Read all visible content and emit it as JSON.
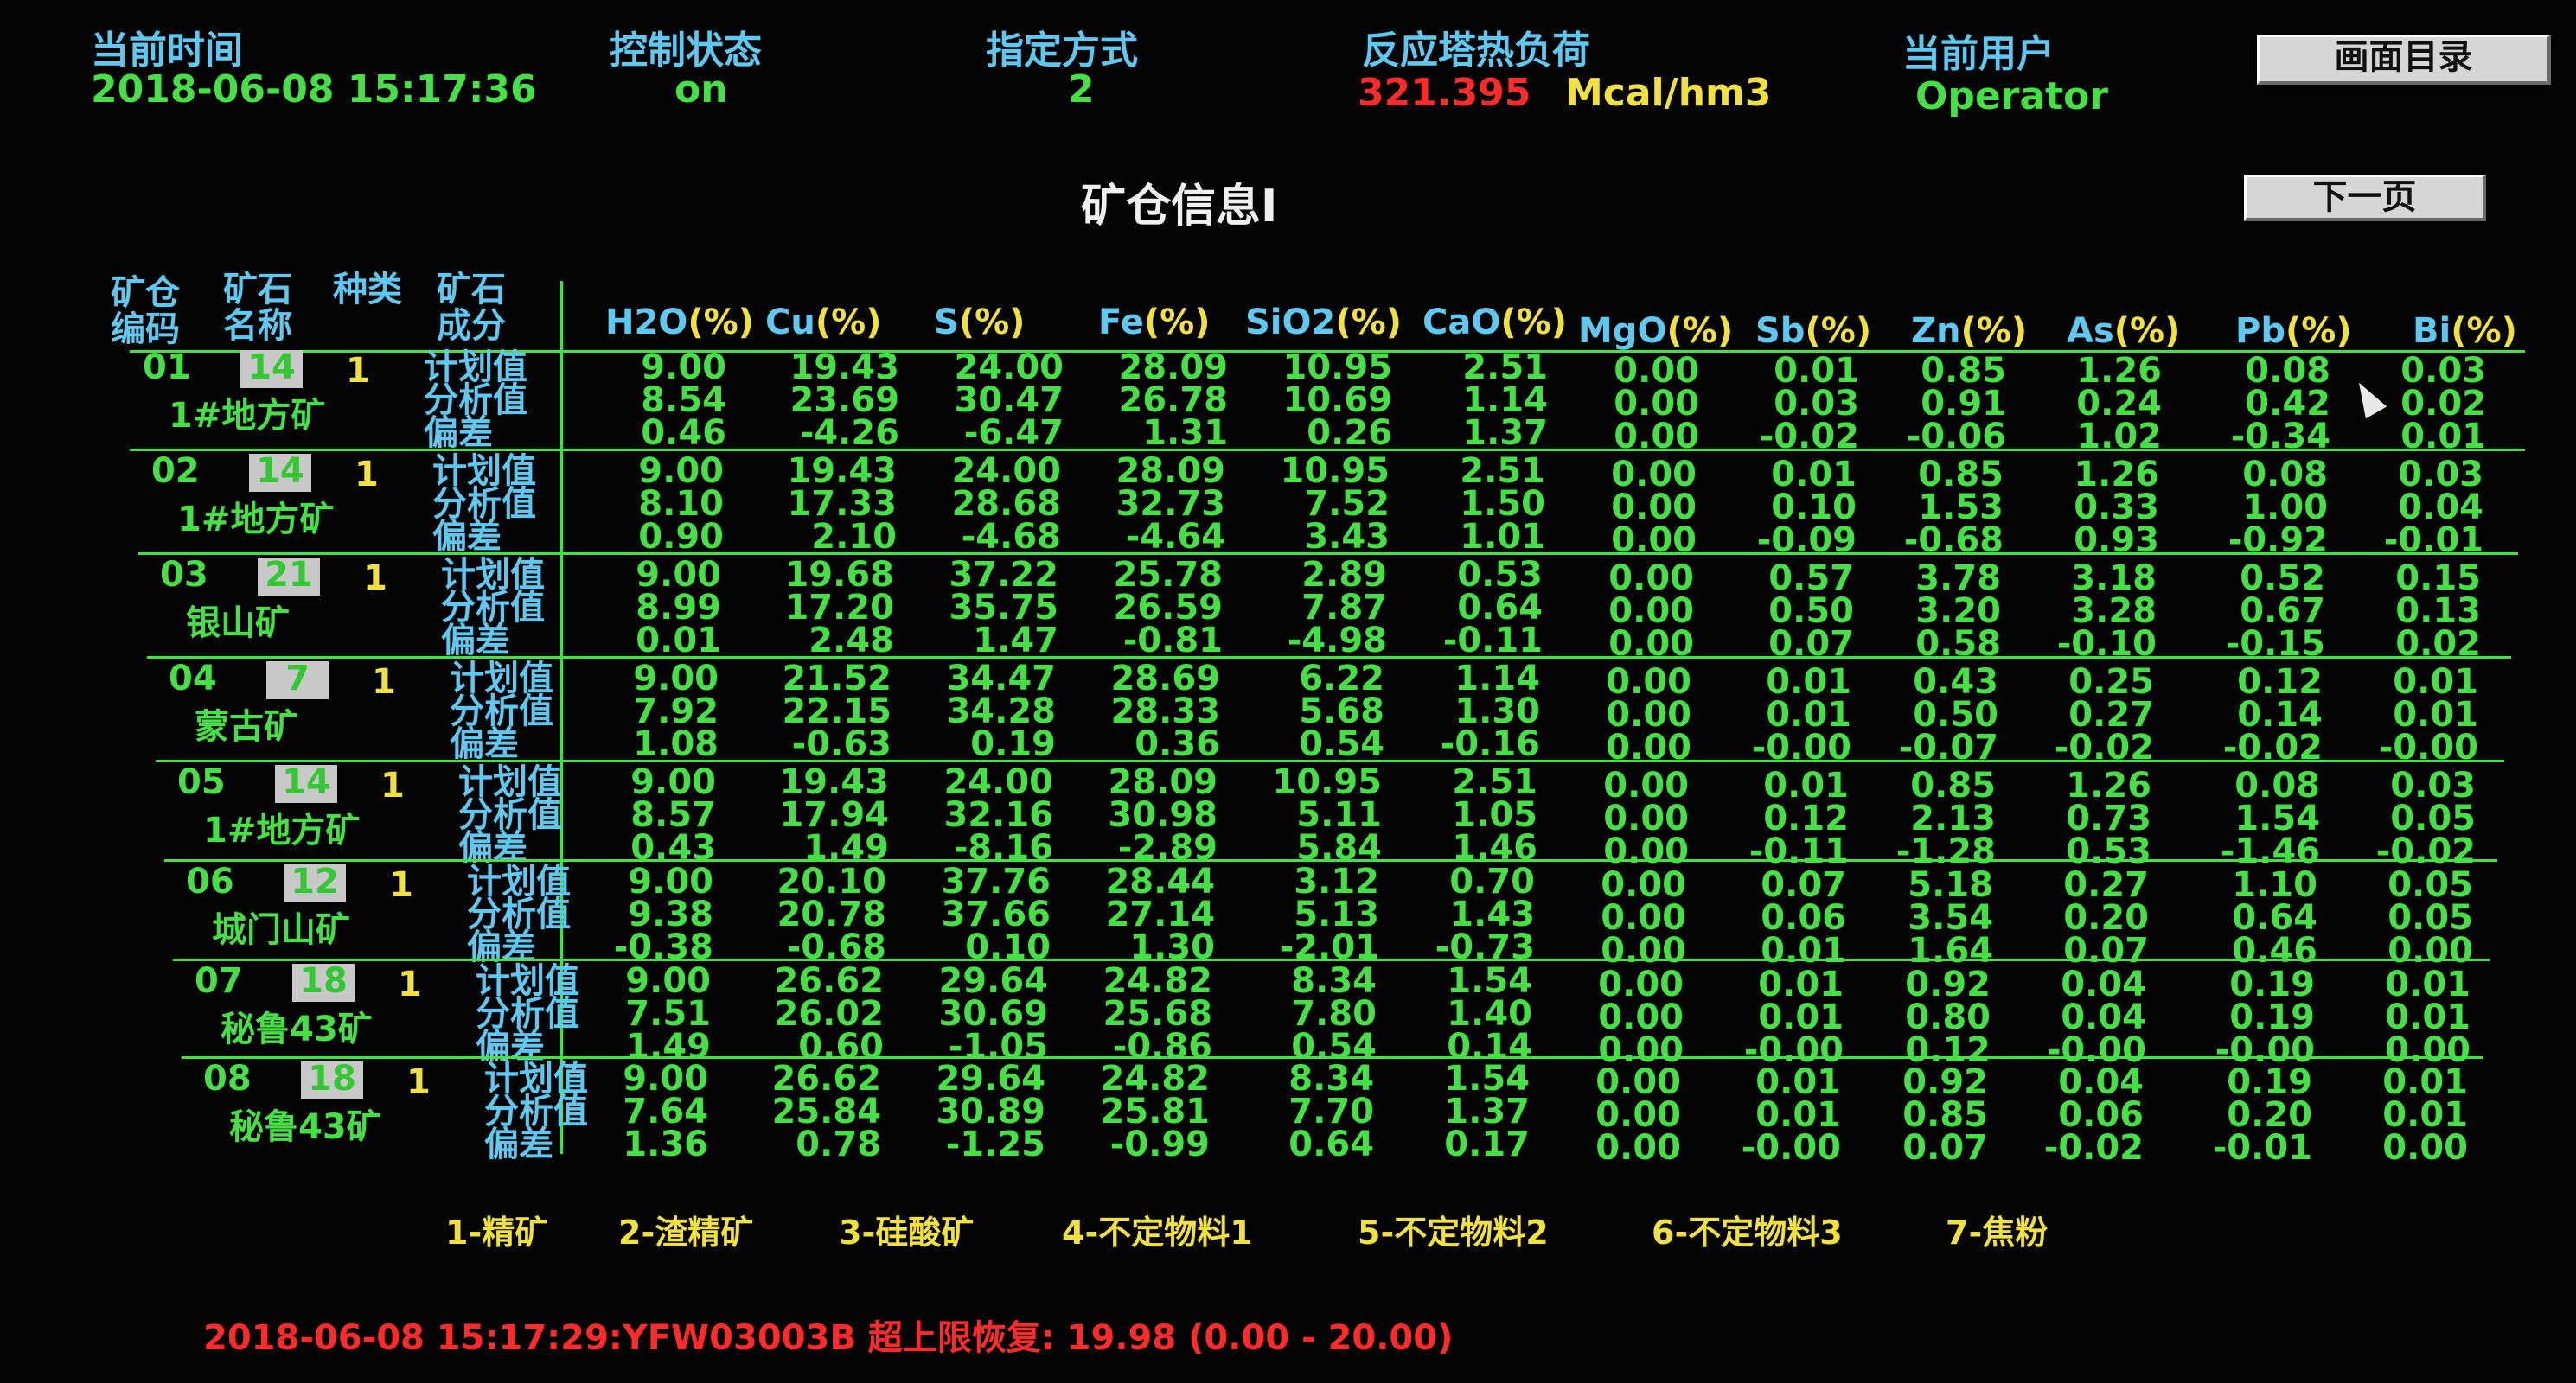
{
  "header": {
    "time_label": "当前时间",
    "time_value": "2018-06-08 15:17:36",
    "control_label": "控制状态",
    "control_value": "on",
    "mode_label": "指定方式",
    "mode_value": "2",
    "heat_label": "反应塔热负荷",
    "heat_value": "321.395",
    "heat_unit": "Mcal/hm3",
    "user_label": "当前用户",
    "user_value": "Operator",
    "menu_button": "画面目录",
    "next_button": "下一页"
  },
  "title": "矿仓信息Ⅰ",
  "table_header": {
    "bin_code_line1": "矿仓",
    "bin_code_line2": "编码",
    "ore_type_line1": "矿石",
    "ore_type_line2": "名称",
    "ore_kind_line1": "种类",
    "component_line1": "矿石",
    "component_line2": "成分",
    "pct": "(%)",
    "columns": [
      "H2O",
      "Cu",
      "S",
      "Fe",
      "SiO2",
      "CaO",
      "MgO",
      "Sb",
      "Zn",
      "As",
      "Pb",
      "Bi"
    ]
  },
  "row_labels": [
    "计划值",
    "分析值",
    "偏差"
  ],
  "bins": [
    {
      "code": "01",
      "ore_type": "14",
      "kind": "1",
      "name": "1#地方矿",
      "plan": [
        "9.00",
        "19.43",
        "24.00",
        "28.09",
        "10.95",
        "2.51",
        "0.00",
        "0.01",
        "0.85",
        "1.26",
        "0.08",
        "0.03"
      ],
      "analysis": [
        "8.54",
        "23.69",
        "30.47",
        "26.78",
        "10.69",
        "1.14",
        "0.00",
        "0.03",
        "0.91",
        "0.24",
        "0.42",
        "0.02"
      ],
      "deviation": [
        "0.46",
        "-4.26",
        "-6.47",
        "1.31",
        "0.26",
        "1.37",
        "0.00",
        "-0.02",
        "-0.06",
        "1.02",
        "-0.34",
        "0.01"
      ]
    },
    {
      "code": "02",
      "ore_type": "14",
      "kind": "1",
      "name": "1#地方矿",
      "plan": [
        "9.00",
        "19.43",
        "24.00",
        "28.09",
        "10.95",
        "2.51",
        "0.00",
        "0.01",
        "0.85",
        "1.26",
        "0.08",
        "0.03"
      ],
      "analysis": [
        "8.10",
        "17.33",
        "28.68",
        "32.73",
        "7.52",
        "1.50",
        "0.00",
        "0.10",
        "1.53",
        "0.33",
        "1.00",
        "0.04"
      ],
      "deviation": [
        "0.90",
        "2.10",
        "-4.68",
        "-4.64",
        "3.43",
        "1.01",
        "0.00",
        "-0.09",
        "-0.68",
        "0.93",
        "-0.92",
        "-0.01"
      ]
    },
    {
      "code": "03",
      "ore_type": "21",
      "kind": "1",
      "name": "银山矿",
      "plan": [
        "9.00",
        "19.68",
        "37.22",
        "25.78",
        "2.89",
        "0.53",
        "0.00",
        "0.57",
        "3.78",
        "3.18",
        "0.52",
        "0.15"
      ],
      "analysis": [
        "8.99",
        "17.20",
        "35.75",
        "26.59",
        "7.87",
        "0.64",
        "0.00",
        "0.50",
        "3.20",
        "3.28",
        "0.67",
        "0.13"
      ],
      "deviation": [
        "0.01",
        "2.48",
        "1.47",
        "-0.81",
        "-4.98",
        "-0.11",
        "0.00",
        "0.07",
        "0.58",
        "-0.10",
        "-0.15",
        "0.02"
      ]
    },
    {
      "code": "04",
      "ore_type": "7",
      "kind": "1",
      "name": "蒙古矿",
      "plan": [
        "9.00",
        "21.52",
        "34.47",
        "28.69",
        "6.22",
        "1.14",
        "0.00",
        "0.01",
        "0.43",
        "0.25",
        "0.12",
        "0.01"
      ],
      "analysis": [
        "7.92",
        "22.15",
        "34.28",
        "28.33",
        "5.68",
        "1.30",
        "0.00",
        "0.01",
        "0.50",
        "0.27",
        "0.14",
        "0.01"
      ],
      "deviation": [
        "1.08",
        "-0.63",
        "0.19",
        "0.36",
        "0.54",
        "-0.16",
        "0.00",
        "-0.00",
        "-0.07",
        "-0.02",
        "-0.02",
        "-0.00"
      ]
    },
    {
      "code": "05",
      "ore_type": "14",
      "kind": "1",
      "name": "1#地方矿",
      "plan": [
        "9.00",
        "19.43",
        "24.00",
        "28.09",
        "10.95",
        "2.51",
        "0.00",
        "0.01",
        "0.85",
        "1.26",
        "0.08",
        "0.03"
      ],
      "analysis": [
        "8.57",
        "17.94",
        "32.16",
        "30.98",
        "5.11",
        "1.05",
        "0.00",
        "0.12",
        "2.13",
        "0.73",
        "1.54",
        "0.05"
      ],
      "deviation": [
        "0.43",
        "1.49",
        "-8.16",
        "-2.89",
        "5.84",
        "1.46",
        "0.00",
        "-0.11",
        "-1.28",
        "0.53",
        "-1.46",
        "-0.02"
      ]
    },
    {
      "code": "06",
      "ore_type": "12",
      "kind": "1",
      "name": "城门山矿",
      "plan": [
        "9.00",
        "20.10",
        "37.76",
        "28.44",
        "3.12",
        "0.70",
        "0.00",
        "0.07",
        "5.18",
        "0.27",
        "1.10",
        "0.05"
      ],
      "analysis": [
        "9.38",
        "20.78",
        "37.66",
        "27.14",
        "5.13",
        "1.43",
        "0.00",
        "0.06",
        "3.54",
        "0.20",
        "0.64",
        "0.05"
      ],
      "deviation": [
        "-0.38",
        "-0.68",
        "0.10",
        "1.30",
        "-2.01",
        "-0.73",
        "0.00",
        "0.01",
        "1.64",
        "0.07",
        "0.46",
        "0.00"
      ]
    },
    {
      "code": "07",
      "ore_type": "18",
      "kind": "1",
      "name": "秘鲁43矿",
      "plan": [
        "9.00",
        "26.62",
        "29.64",
        "24.82",
        "8.34",
        "1.54",
        "0.00",
        "0.01",
        "0.92",
        "0.04",
        "0.19",
        "0.01"
      ],
      "analysis": [
        "7.51",
        "26.02",
        "30.69",
        "25.68",
        "7.80",
        "1.40",
        "0.00",
        "0.01",
        "0.80",
        "0.04",
        "0.19",
        "0.01"
      ],
      "deviation": [
        "1.49",
        "0.60",
        "-1.05",
        "-0.86",
        "0.54",
        "0.14",
        "0.00",
        "-0.00",
        "0.12",
        "-0.00",
        "-0.00",
        "0.00"
      ]
    },
    {
      "code": "08",
      "ore_type": "18",
      "kind": "1",
      "name": "秘鲁43矿",
      "plan": [
        "9.00",
        "26.62",
        "29.64",
        "24.82",
        "8.34",
        "1.54",
        "0.00",
        "0.01",
        "0.92",
        "0.04",
        "0.19",
        "0.01"
      ],
      "analysis": [
        "7.64",
        "25.84",
        "30.89",
        "25.81",
        "7.70",
        "1.37",
        "0.00",
        "0.01",
        "0.85",
        "0.06",
        "0.20",
        "0.01"
      ],
      "deviation": [
        "1.36",
        "0.78",
        "-1.25",
        "-0.99",
        "0.64",
        "0.17",
        "0.00",
        "-0.00",
        "0.07",
        "-0.02",
        "-0.01",
        "0.00"
      ]
    }
  ],
  "legend": [
    "1-精矿",
    "2-渣精矿",
    "3-硅酸矿",
    "4-不定物料1",
    "5-不定物料2",
    "6-不定物料3",
    "7-焦粉"
  ],
  "alarm": "2018-06-08 15:17:29:YFW03003B 超上限恢复: 19.98 (0.00 - 20.00)",
  "colors": {
    "background": "#040404",
    "label_blue": "#5ec8f0",
    "value_green": "#46e046",
    "yellow": "#f0e040",
    "alarm_red": "#ff2a2a"
  }
}
